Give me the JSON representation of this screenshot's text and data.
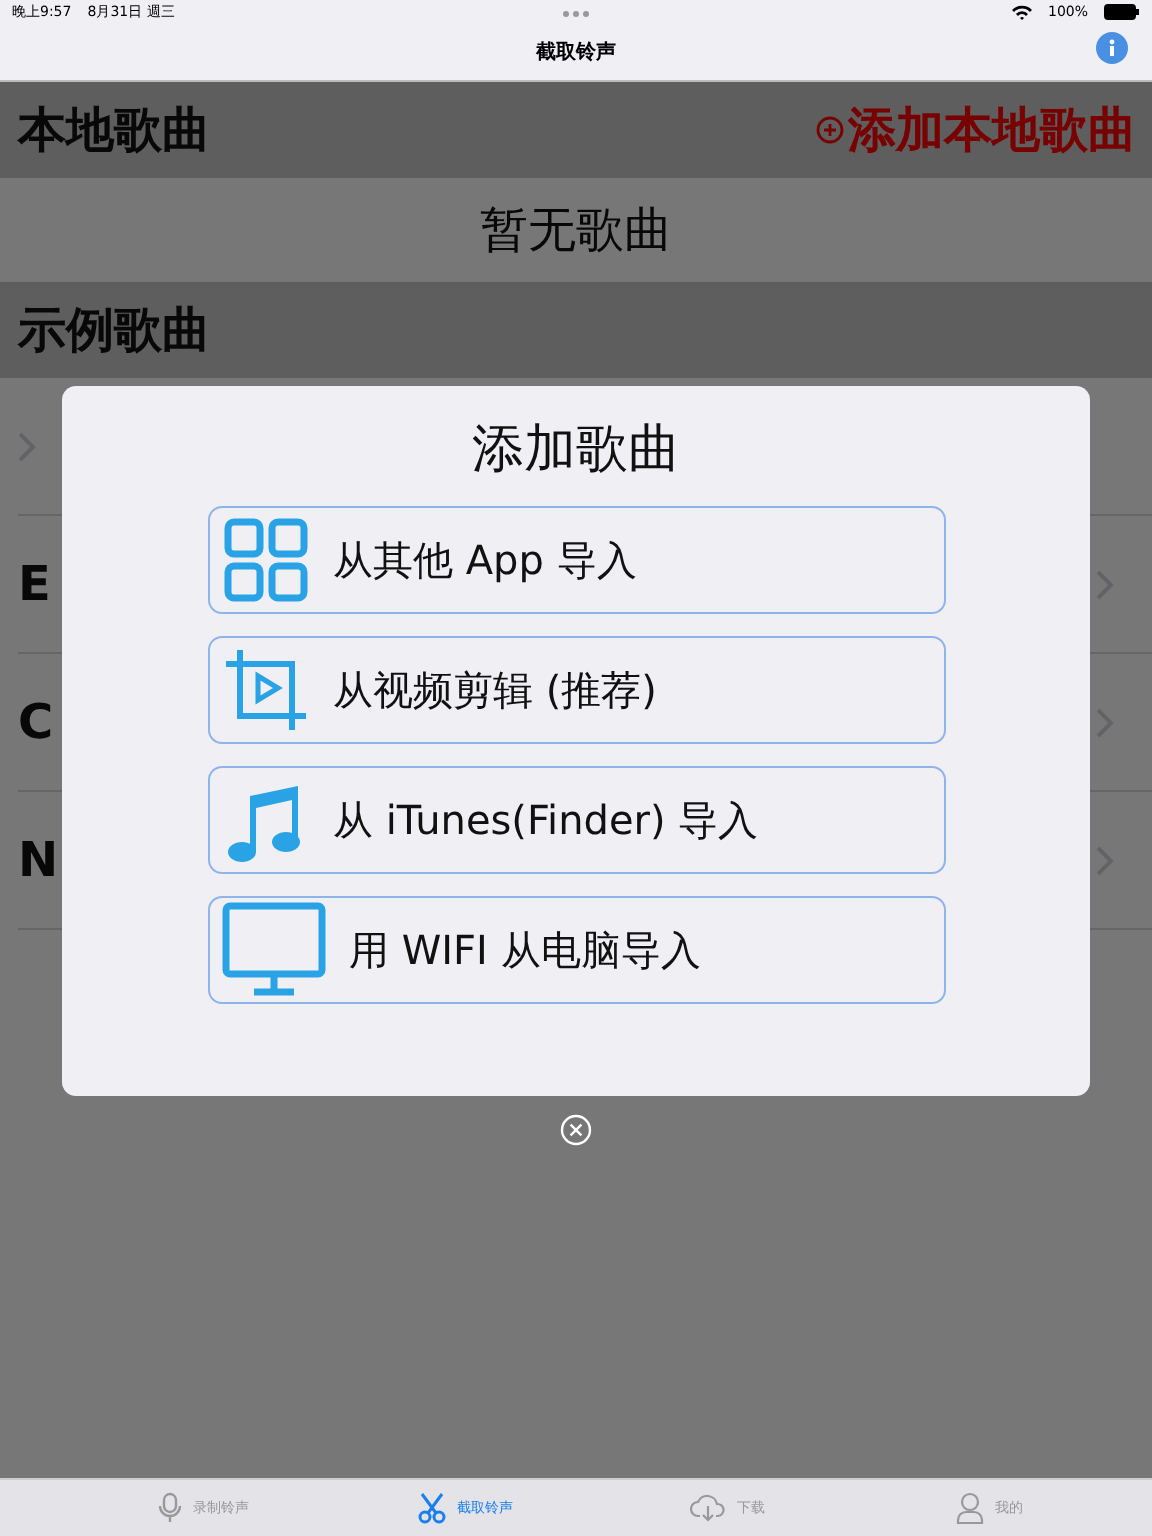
{
  "status_bar": {
    "time": "晚上9:57",
    "date": "8月31日 週三",
    "battery": "100%"
  },
  "nav": {
    "title": "截取铃声"
  },
  "local_section": {
    "title": "本地歌曲",
    "add_label": "添加本地歌曲",
    "empty_text": "暂无歌曲"
  },
  "sample_section": {
    "title": "示例歌曲",
    "rows": [
      {},
      {
        "label": "E"
      },
      {
        "label": "C"
      },
      {
        "label": "N"
      }
    ]
  },
  "dialog": {
    "title": "添加歌曲",
    "options": [
      {
        "kind": "apps",
        "label": "从其他 App 导入"
      },
      {
        "kind": "video",
        "label": "从视频剪辑 (推荐)"
      },
      {
        "kind": "music",
        "label": "从 iTunes(Finder) 导入"
      },
      {
        "kind": "computer",
        "label": "用 WIFI 从电脑导入"
      }
    ]
  },
  "tabs": [
    {
      "kind": "mic",
      "label": "录制铃声",
      "selected": false
    },
    {
      "kind": "scissors",
      "label": "截取铃声",
      "selected": true
    },
    {
      "kind": "download",
      "label": "下载",
      "selected": false
    },
    {
      "kind": "person",
      "label": "我的",
      "selected": false
    }
  ]
}
